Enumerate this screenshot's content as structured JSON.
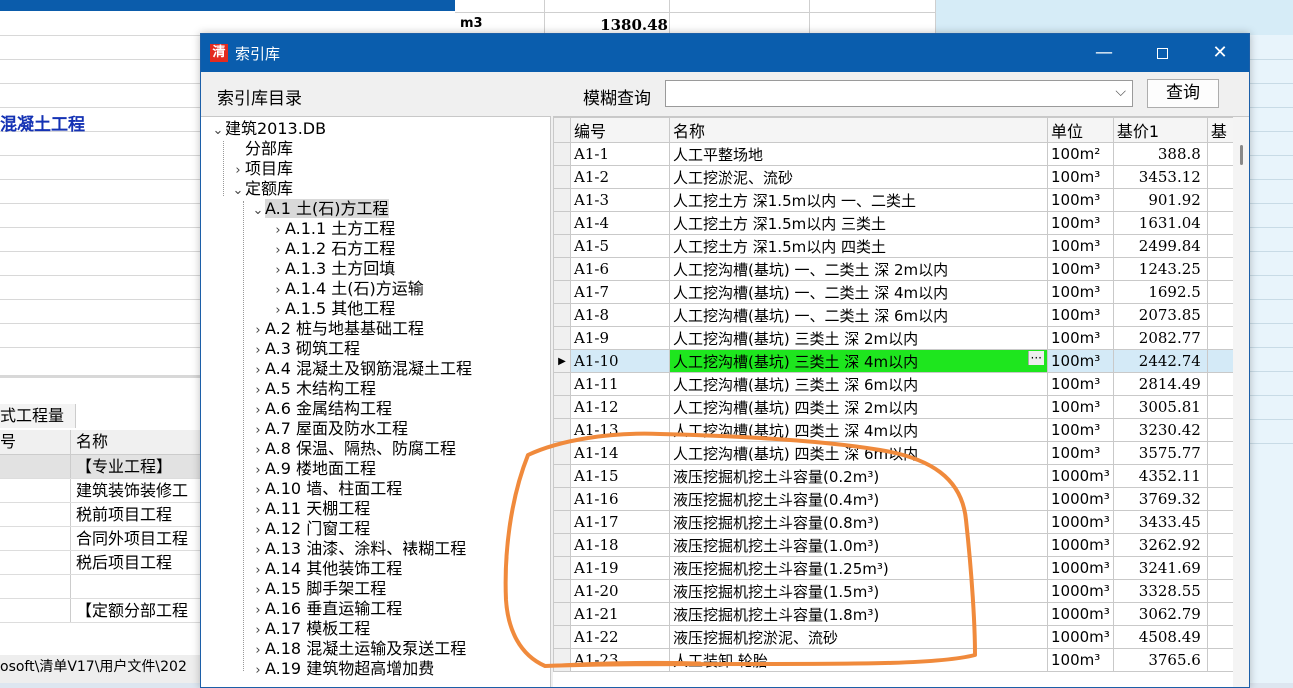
{
  "background": {
    "unit": "m3",
    "value": "1380.48",
    "heading": "混凝土工程",
    "tab_label": "式工程量",
    "table_headers": [
      "号",
      "名称"
    ],
    "table_rows": [
      "【专业工程】",
      "建筑装饰装修工",
      "税前项目工程",
      "合同外项目工程",
      "税后项目工程",
      "",
      "【定额分部工程"
    ],
    "status_path": "osoft\\清单V17\\用户文件\\202"
  },
  "dialog": {
    "title": "索引库",
    "app_icon_glyph": "清",
    "tree_label": "索引库目录",
    "search_label": "模糊查询",
    "search_value": "",
    "query_button": "查询",
    "tree": [
      {
        "depth": 0,
        "toggle": "v",
        "label": "建筑2013.DB"
      },
      {
        "depth": 1,
        "toggle": "",
        "label": "分部库"
      },
      {
        "depth": 1,
        "toggle": ">",
        "label": "项目库"
      },
      {
        "depth": 1,
        "toggle": "v",
        "label": "定额库"
      },
      {
        "depth": 2,
        "toggle": "v",
        "label": "A.1 土(石)方工程",
        "selected": true
      },
      {
        "depth": 3,
        "toggle": ">",
        "label": "A.1.1 土方工程"
      },
      {
        "depth": 3,
        "toggle": ">",
        "label": "A.1.2 石方工程"
      },
      {
        "depth": 3,
        "toggle": ">",
        "label": "A.1.3 土方回填"
      },
      {
        "depth": 3,
        "toggle": ">",
        "label": "A.1.4 土(石)方运输"
      },
      {
        "depth": 3,
        "toggle": ">",
        "label": "A.1.5 其他工程"
      },
      {
        "depth": 2,
        "toggle": ">",
        "label": "A.2 桩与地基基础工程"
      },
      {
        "depth": 2,
        "toggle": ">",
        "label": "A.3 砌筑工程"
      },
      {
        "depth": 2,
        "toggle": ">",
        "label": "A.4 混凝土及钢筋混凝土工程"
      },
      {
        "depth": 2,
        "toggle": ">",
        "label": "A.5 木结构工程"
      },
      {
        "depth": 2,
        "toggle": ">",
        "label": "A.6 金属结构工程"
      },
      {
        "depth": 2,
        "toggle": ">",
        "label": "A.7 屋面及防水工程"
      },
      {
        "depth": 2,
        "toggle": ">",
        "label": "A.8 保温、隔热、防腐工程"
      },
      {
        "depth": 2,
        "toggle": ">",
        "label": "A.9 楼地面工程"
      },
      {
        "depth": 2,
        "toggle": ">",
        "label": "A.10 墙、柱面工程"
      },
      {
        "depth": 2,
        "toggle": ">",
        "label": "A.11 天棚工程"
      },
      {
        "depth": 2,
        "toggle": ">",
        "label": "A.12 门窗工程"
      },
      {
        "depth": 2,
        "toggle": ">",
        "label": "A.13 油漆、涂料、裱糊工程"
      },
      {
        "depth": 2,
        "toggle": ">",
        "label": "A.14 其他装饰工程"
      },
      {
        "depth": 2,
        "toggle": ">",
        "label": "A.15 脚手架工程"
      },
      {
        "depth": 2,
        "toggle": ">",
        "label": "A.16 垂直运输工程"
      },
      {
        "depth": 2,
        "toggle": ">",
        "label": "A.17 模板工程"
      },
      {
        "depth": 2,
        "toggle": ">",
        "label": "A.18 混凝土运输及泵送工程"
      },
      {
        "depth": 2,
        "toggle": ">",
        "label": "A.19 建筑物超高增加费"
      }
    ],
    "grid": {
      "headers": [
        "编号",
        "名称",
        "单位",
        "基价1",
        "基"
      ],
      "rows": [
        {
          "code": "A1-1",
          "name": "人工平整场地",
          "unit": "100m²",
          "price": "388.8"
        },
        {
          "code": "A1-2",
          "name": "人工挖淤泥、流砂",
          "unit": "100m³",
          "price": "3453.12"
        },
        {
          "code": "A1-3",
          "name": "人工挖土方 深1.5m以内 一、二类土",
          "unit": "100m³",
          "price": "901.92"
        },
        {
          "code": "A1-4",
          "name": "人工挖土方 深1.5m以内 三类土",
          "unit": "100m³",
          "price": "1631.04"
        },
        {
          "code": "A1-5",
          "name": "人工挖土方 深1.5m以内 四类土",
          "unit": "100m³",
          "price": "2499.84"
        },
        {
          "code": "A1-6",
          "name": "人工挖沟槽(基坑) 一、二类土 深 2m以内",
          "unit": "100m³",
          "price": "1243.25"
        },
        {
          "code": "A1-7",
          "name": "人工挖沟槽(基坑) 一、二类土 深 4m以内",
          "unit": "100m³",
          "price": "1692.5"
        },
        {
          "code": "A1-8",
          "name": "人工挖沟槽(基坑) 一、二类土 深 6m以内",
          "unit": "100m³",
          "price": "2073.85"
        },
        {
          "code": "A1-9",
          "name": "人工挖沟槽(基坑) 三类土 深 2m以内",
          "unit": "100m³",
          "price": "2082.77"
        },
        {
          "code": "A1-10",
          "name": "人工挖沟槽(基坑) 三类土 深 4m以内",
          "unit": "100m³",
          "price": "2442.74",
          "selected": true
        },
        {
          "code": "A1-11",
          "name": "人工挖沟槽(基坑) 三类土 深 6m以内",
          "unit": "100m³",
          "price": "2814.49"
        },
        {
          "code": "A1-12",
          "name": "人工挖沟槽(基坑) 四类土 深 2m以内",
          "unit": "100m³",
          "price": "3005.81"
        },
        {
          "code": "A1-13",
          "name": "人工挖沟槽(基坑) 四类土 深 4m以内",
          "unit": "100m³",
          "price": "3230.42"
        },
        {
          "code": "A1-14",
          "name": "人工挖沟槽(基坑) 四类土 深 6m以内",
          "unit": "100m³",
          "price": "3575.77"
        },
        {
          "code": "A1-15",
          "name": "液压挖掘机挖土斗容量(0.2m³)",
          "unit": "1000m³",
          "price": "4352.11"
        },
        {
          "code": "A1-16",
          "name": "液压挖掘机挖土斗容量(0.4m³)",
          "unit": "1000m³",
          "price": "3769.32"
        },
        {
          "code": "A1-17",
          "name": "液压挖掘机挖土斗容量(0.8m³)",
          "unit": "1000m³",
          "price": "3433.45"
        },
        {
          "code": "A1-18",
          "name": "液压挖掘机挖土斗容量(1.0m³)",
          "unit": "1000m³",
          "price": "3262.92"
        },
        {
          "code": "A1-19",
          "name": "液压挖掘机挖土斗容量(1.25m³)",
          "unit": "1000m³",
          "price": "3241.69"
        },
        {
          "code": "A1-20",
          "name": "液压挖掘机挖土斗容量(1.5m³)",
          "unit": "1000m³",
          "price": "3328.55"
        },
        {
          "code": "A1-21",
          "name": "液压挖掘机挖土斗容量(1.8m³)",
          "unit": "1000m³",
          "price": "3062.79"
        },
        {
          "code": "A1-22",
          "name": "液压挖掘机挖淤泥、流砂",
          "unit": "1000m³",
          "price": "4508.49"
        },
        {
          "code": "A1-23",
          "name": "人工装卸 轮胎",
          "unit": "100m³",
          "price": "3765.6"
        }
      ]
    }
  },
  "colors": {
    "titlebar": "#0a5dad",
    "selected_name_cell": "#1ee61e",
    "annotation": "#f08a3c"
  }
}
